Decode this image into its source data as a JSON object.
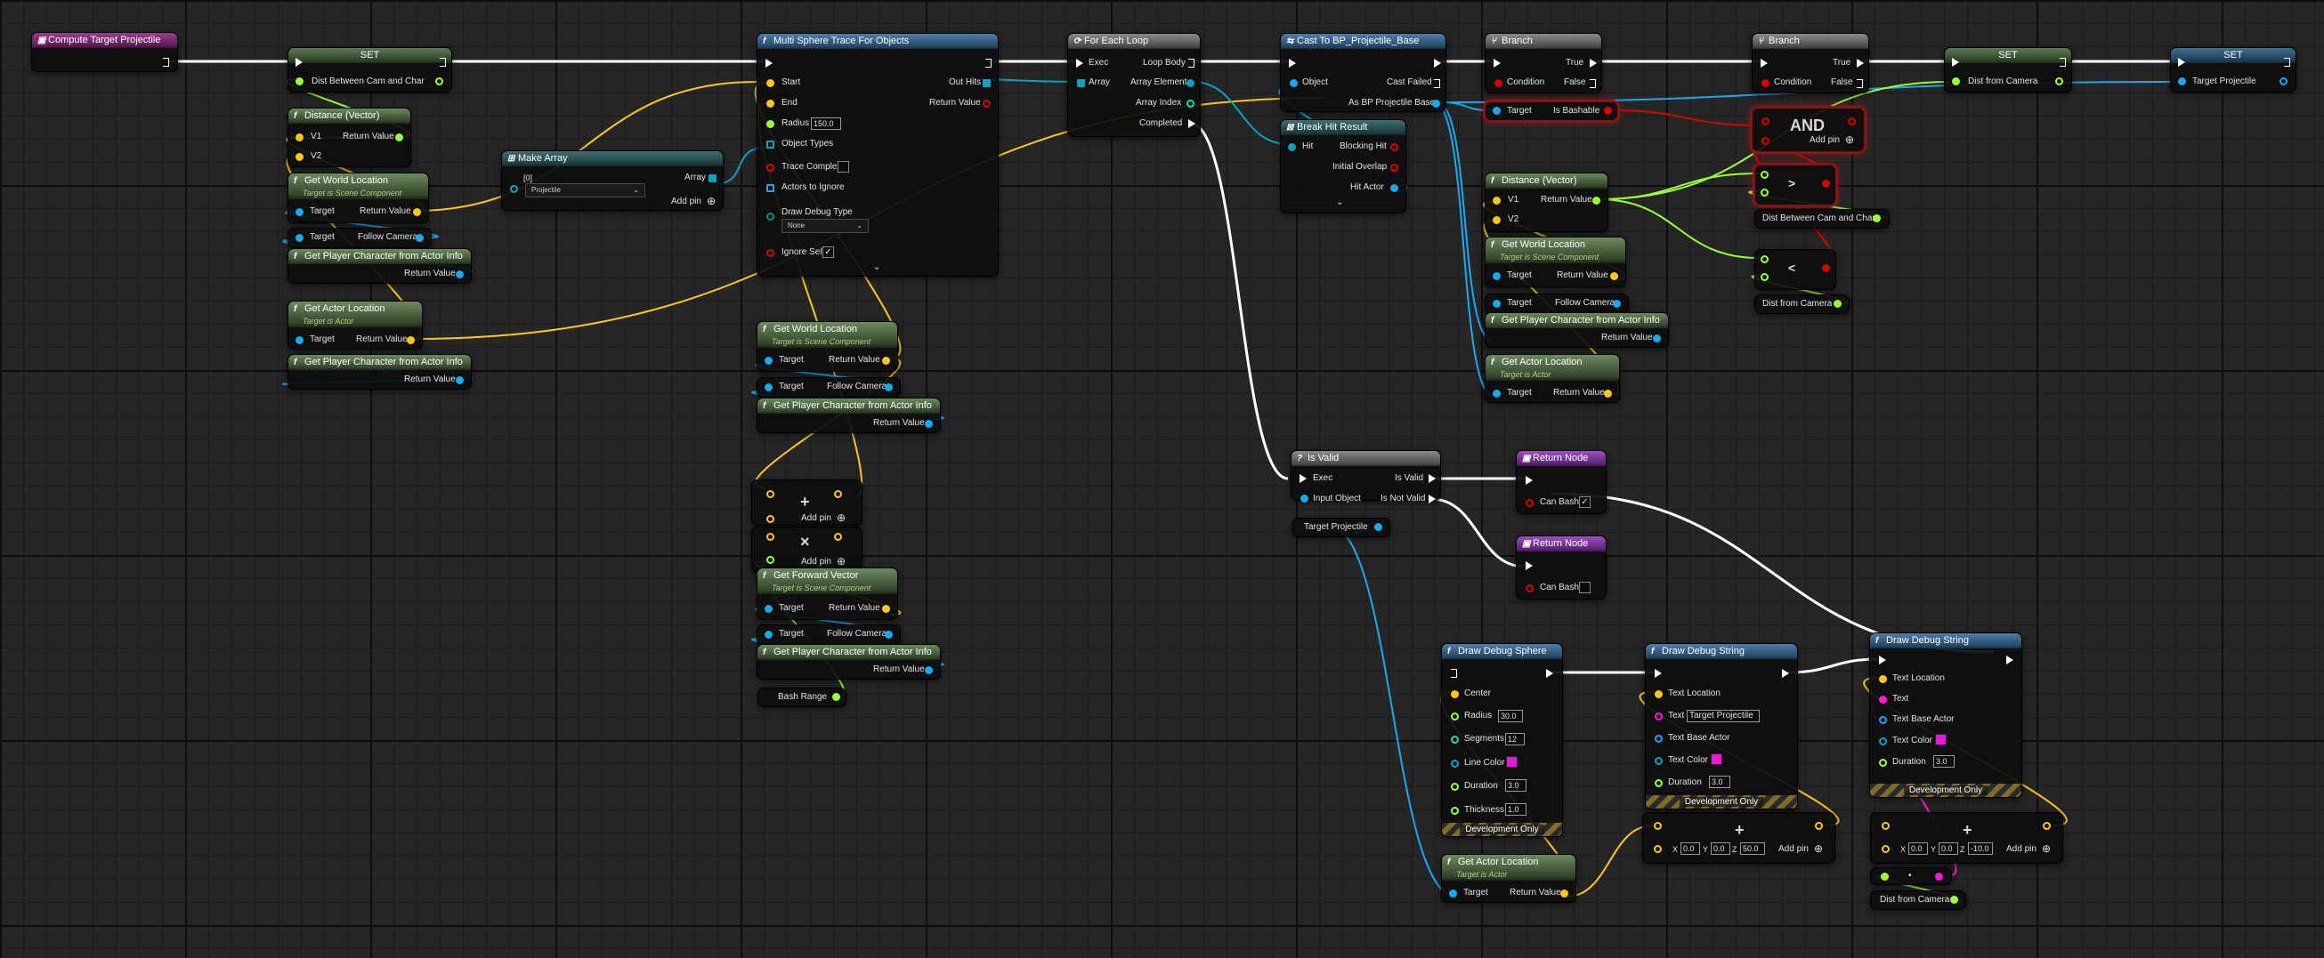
{
  "colors": {
    "exec": "#ffffff",
    "object": "#1aa8f0",
    "vector": "#fdc71c",
    "float": "#9dff3a",
    "bool": "#d80000",
    "string": "#ff1ad1",
    "struct": "#0ba2c2",
    "wire": "#9a9a9a"
  },
  "compute": {
    "title": "Compute Target Projectile"
  },
  "set1": {
    "title": "SET",
    "var": "Dist Between Cam and Char"
  },
  "dist1": {
    "title": "Distance (Vector)",
    "v1": "V1",
    "v2": "V2",
    "ret": "Return Value"
  },
  "gwl1": {
    "title": "Get World Location",
    "sub": "Target is Scene Component",
    "target": "Target",
    "ret": "Return Value"
  },
  "fc1": {
    "target": "Target",
    "out": "Follow Camera"
  },
  "gpc1": {
    "title": "Get Player Character from Actor Info",
    "ret": "Return Value"
  },
  "gal1": {
    "title": "Get Actor Location",
    "sub": "Target is Actor",
    "target": "Target",
    "ret": "Return Value"
  },
  "gpc2": {
    "title": "Get Player Character from Actor Info",
    "ret": "Return Value"
  },
  "makearr": {
    "title": "Make Array",
    "index": "[0]",
    "value": "Projectile",
    "out": "Array",
    "add": "Add pin"
  },
  "trace": {
    "title": "Multi Sphere Trace For Objects",
    "start": "Start",
    "end": "End",
    "radius": "Radius",
    "radius_val": "150.0",
    "objtypes": "Object Types",
    "complex": "Trace Complex",
    "ignore": "Actors to Ignore",
    "debug": "Draw Debug Type",
    "debug_val": "None",
    "self": "Ignore Self",
    "self_check": "✓",
    "outhits": "Out Hits",
    "ret": "Return Value"
  },
  "gwl2": {
    "title": "Get World Location",
    "sub": "Target is Scene Component",
    "target": "Target",
    "ret": "Return Value"
  },
  "fc2": {
    "target": "Target",
    "out": "Follow Camera"
  },
  "gpc3": {
    "title": "Get Player Character from Actor Info",
    "ret": "Return Value"
  },
  "add1": {
    "sym": "+",
    "add": "Add pin"
  },
  "mul1": {
    "sym": "×",
    "add": "Add pin"
  },
  "gfv": {
    "title": "Get Forward Vector",
    "sub": "Target is Scene Component",
    "target": "Target",
    "ret": "Return Value"
  },
  "fc3": {
    "target": "Target",
    "out": "Follow Camera"
  },
  "gpc4": {
    "title": "Get Player Character from Actor Info",
    "ret": "Return Value"
  },
  "bash": {
    "label": "Bash Range"
  },
  "foreach": {
    "title": "For Each Loop",
    "exec": "Exec",
    "array": "Array",
    "body": "Loop Body",
    "elem": "Array Element",
    "index": "Array Index",
    "done": "Completed"
  },
  "cast": {
    "title": "Cast To BP_Projectile_Base",
    "obj": "Object",
    "failed": "Cast Failed",
    "as": "As BP Projectile Base"
  },
  "bhr": {
    "title": "Break Hit Result",
    "hit": "Hit",
    "blocking": "Blocking Hit",
    "overlap": "Initial Overlap",
    "actor": "Hit Actor"
  },
  "branch1": {
    "title": "Branch",
    "cond": "Condition",
    "t": "True",
    "f": "False"
  },
  "isbash": {
    "target": "Target",
    "out": "Is Bashable"
  },
  "dist2": {
    "title": "Distance (Vector)",
    "v1": "V1",
    "v2": "V2",
    "ret": "Return Value"
  },
  "gwl3": {
    "title": "Get World Location",
    "sub": "Target is Scene Component",
    "target": "Target",
    "ret": "Return Value"
  },
  "fc4": {
    "target": "Target",
    "out": "Follow Camera"
  },
  "gpc5": {
    "title": "Get Player Character from Actor Info",
    "ret": "Return Value"
  },
  "gal2": {
    "title": "Get Actor Location",
    "sub": "Target is Actor",
    "target": "Target",
    "ret": "Return Value"
  },
  "branch2": {
    "title": "Branch",
    "cond": "Condition",
    "t": "True",
    "f": "False"
  },
  "andn": {
    "title": "AND",
    "add": "Add pin"
  },
  "gt": {
    "sym": ">"
  },
  "lt": {
    "sym": "<"
  },
  "getdbc": {
    "label": "Dist Between Cam and Char"
  },
  "getdfc1": {
    "label": "Dist from Camera"
  },
  "set2": {
    "title": "SET",
    "var": "Dist from Camera"
  },
  "set3": {
    "title": "SET",
    "var": "Target Projectile"
  },
  "isvalid": {
    "title": "Is Valid",
    "exec": "Exec",
    "input": "Input Object",
    "valid": "Is Valid",
    "notvalid": "Is Not Valid"
  },
  "gettp": {
    "label": "Target Projectile"
  },
  "ret1": {
    "title": "Return Node",
    "canbash": "Can Bash",
    "check": "✓"
  },
  "ret2": {
    "title": "Return Node",
    "canbash": "Can Bash"
  },
  "dsphere": {
    "title": "Draw Debug Sphere",
    "center": "Center",
    "radius": "Radius",
    "radius_val": "30.0",
    "segments": "Segments",
    "segments_val": "12",
    "color": "Line Color",
    "duration": "Duration",
    "duration_val": "3.0",
    "thick": "Thickness",
    "thick_val": "1.0",
    "dev": "Development Only"
  },
  "gal3": {
    "title": "Get Actor Location",
    "sub": "Target is Actor",
    "target": "Target",
    "ret": "Return Value"
  },
  "dstr1": {
    "title": "Draw Debug String",
    "loc": "Text Location",
    "text": "Text",
    "text_val": "Target Projectile",
    "base": "Text Base Actor",
    "color": "Text Color",
    "duration": "Duration",
    "duration_val": "3.0",
    "dev": "Development Only"
  },
  "add2": {
    "sym": "+",
    "xl": "X",
    "xv": "0.0",
    "yl": "Y",
    "yv": "0.0",
    "zl": "Z",
    "zv": "50.0",
    "add": "Add pin"
  },
  "dstr2": {
    "title": "Draw Debug String",
    "loc": "Text Location",
    "text": "Text",
    "base": "Text Base Actor",
    "color": "Text Color",
    "duration": "Duration",
    "duration_val": "3.0",
    "dev": "Development Only"
  },
  "add3": {
    "sym": "+",
    "xl": "X",
    "xv": "0.0",
    "yl": "Y",
    "yv": "0.0",
    "zl": "Z",
    "zv": "-10.0",
    "add": "Add pin"
  },
  "conv": {
    "sym": "•"
  },
  "getdfc2": {
    "label": "Dist from Camera"
  }
}
